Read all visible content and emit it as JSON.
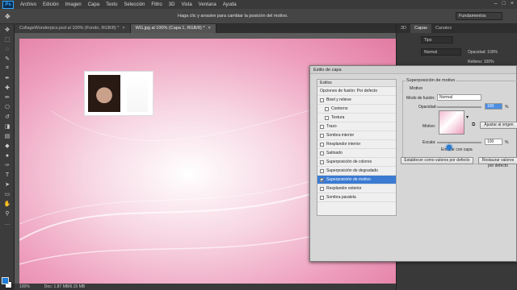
{
  "app": {
    "logo": "Ps"
  },
  "menubar": {
    "items": [
      "Archivo",
      "Edición",
      "Imagen",
      "Capa",
      "Texto",
      "Selección",
      "Filtro",
      "3D",
      "Vista",
      "Ventana",
      "Ayuda"
    ]
  },
  "options_bar": {
    "hint": "Haga clic y arrastre para cambiar la posición del motivo.",
    "workspace": "Fundamentos"
  },
  "documents": {
    "tabs": [
      {
        "label": "CollageWonderpics.psd al 100% (Fondo, RGB/8) *",
        "close": "×"
      },
      {
        "label": "WG.jpg al 100% (Capa 1, RGB/8) *",
        "close": "×"
      }
    ]
  },
  "status": {
    "zoom": "100%",
    "doc": "Doc: 1.87 MB/6.15 MB"
  },
  "dock": {
    "tabs": [
      "3D",
      "Capas",
      "Canales"
    ],
    "filter": "Tipo",
    "blend": "Normal",
    "opacity_label": "Opacidad: 100%",
    "fill_label": "Relleno: 100%"
  },
  "dialog": {
    "title": "Estilo de capa",
    "styles_header": "Estilos",
    "styles": [
      {
        "label": "Opciones de fusión: Por defecto",
        "checkbox": false,
        "sub": false,
        "checked": false,
        "selected": false
      },
      {
        "label": "Bisel y relieve",
        "checkbox": true,
        "sub": false,
        "checked": false,
        "selected": false
      },
      {
        "label": "Contorno",
        "checkbox": true,
        "sub": true,
        "checked": false,
        "selected": false
      },
      {
        "label": "Textura",
        "checkbox": true,
        "sub": true,
        "checked": false,
        "selected": false
      },
      {
        "label": "Trazo",
        "checkbox": true,
        "sub": false,
        "checked": false,
        "selected": false
      },
      {
        "label": "Sombra interior",
        "checkbox": true,
        "sub": false,
        "checked": false,
        "selected": false
      },
      {
        "label": "Resplandor interior",
        "checkbox": true,
        "sub": false,
        "checked": false,
        "selected": false
      },
      {
        "label": "Satinado",
        "checkbox": true,
        "sub": false,
        "checked": false,
        "selected": false
      },
      {
        "label": "Superposición de colores",
        "checkbox": true,
        "sub": false,
        "checked": false,
        "selected": false
      },
      {
        "label": "Superposición de degradado",
        "checkbox": true,
        "sub": false,
        "checked": false,
        "selected": false
      },
      {
        "label": "Superposición de motivo",
        "checkbox": true,
        "sub": false,
        "checked": true,
        "selected": true
      },
      {
        "label": "Resplandor exterior",
        "checkbox": true,
        "sub": false,
        "checked": false,
        "selected": false
      },
      {
        "label": "Sombra paralela",
        "checkbox": true,
        "sub": false,
        "checked": false,
        "selected": false
      }
    ],
    "section_title": "Superposición de motivo",
    "group_title": "Motivo",
    "blend_label": "Modo de fusión:",
    "blend_value": "Normal",
    "opacity_label": "Opacidad:",
    "opacity_value": "100",
    "percent": "%",
    "pattern_label": "Motivo:",
    "snap_button": "Ajustar al origen",
    "scale_label": "Escala:",
    "scale_value": "100",
    "link_label": "Enlazar con capa",
    "default_button": "Establecer como valores por defecto",
    "reset_button": "Restaurar valores por defecto"
  }
}
